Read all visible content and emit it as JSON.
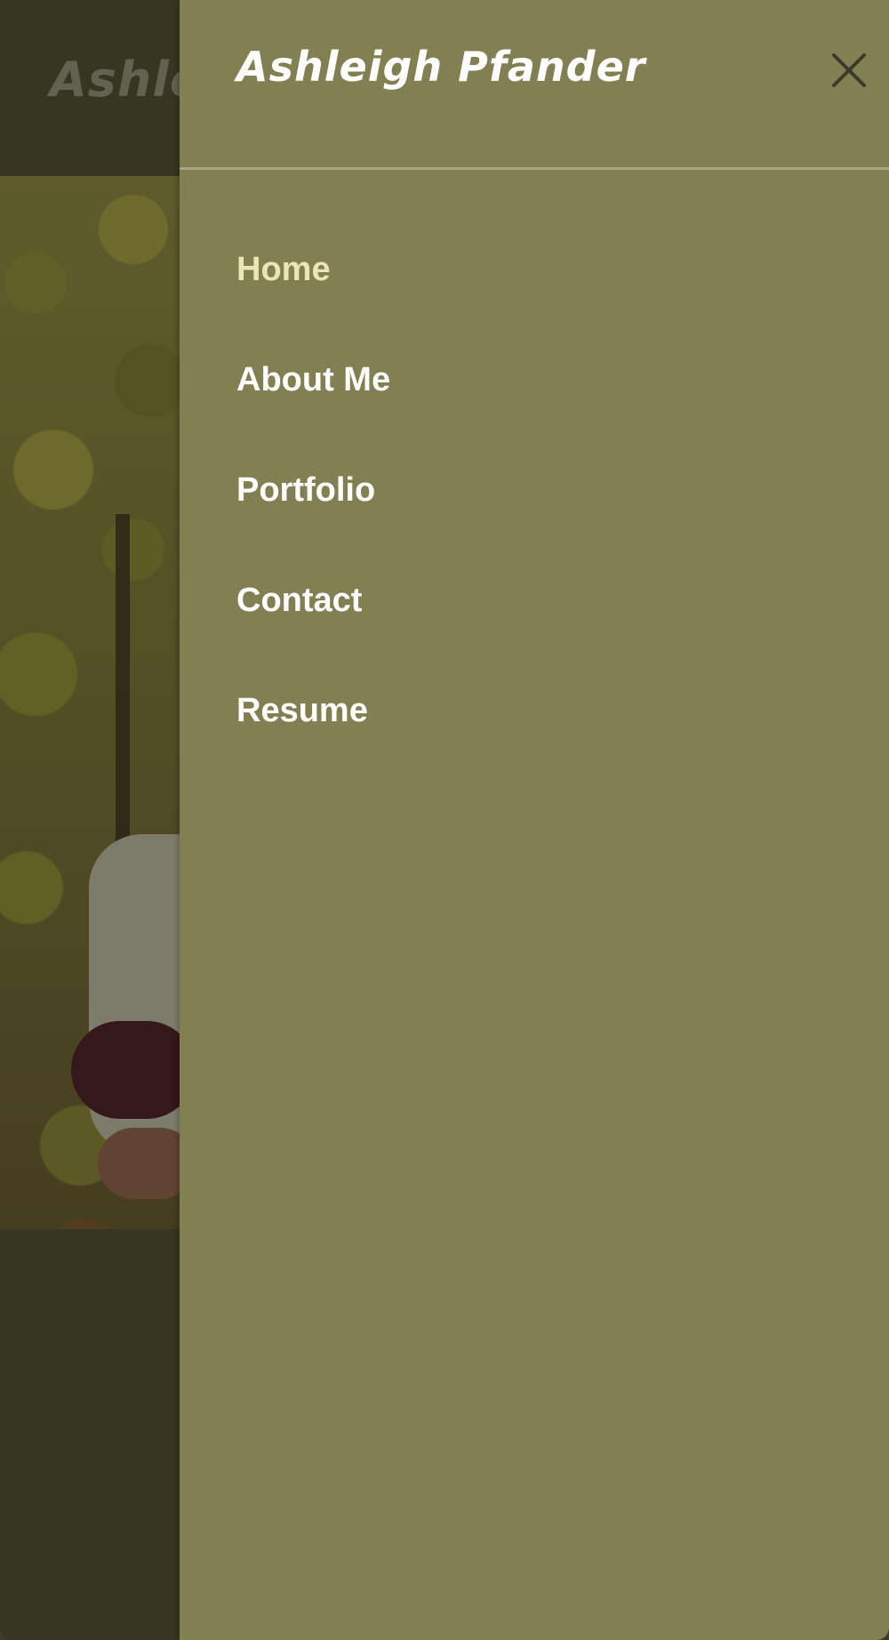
{
  "page": {
    "logo_text": "Ashleigh Pfander"
  },
  "drawer": {
    "title": "Ashleigh Pfander",
    "close_icon": "close-icon",
    "nav_items": [
      {
        "label": "Home",
        "active": true
      },
      {
        "label": "About Me",
        "active": false
      },
      {
        "label": "Portfolio",
        "active": false
      },
      {
        "label": "Contact",
        "active": false
      },
      {
        "label": "Resume",
        "active": false
      }
    ]
  },
  "colors": {
    "drawer_background": "#828053",
    "page_background": "#3d3c26",
    "active_link": "#ece5b4",
    "link": "#ffffff",
    "divider": "#a7a680",
    "close_icon": "#3a3a2a"
  }
}
